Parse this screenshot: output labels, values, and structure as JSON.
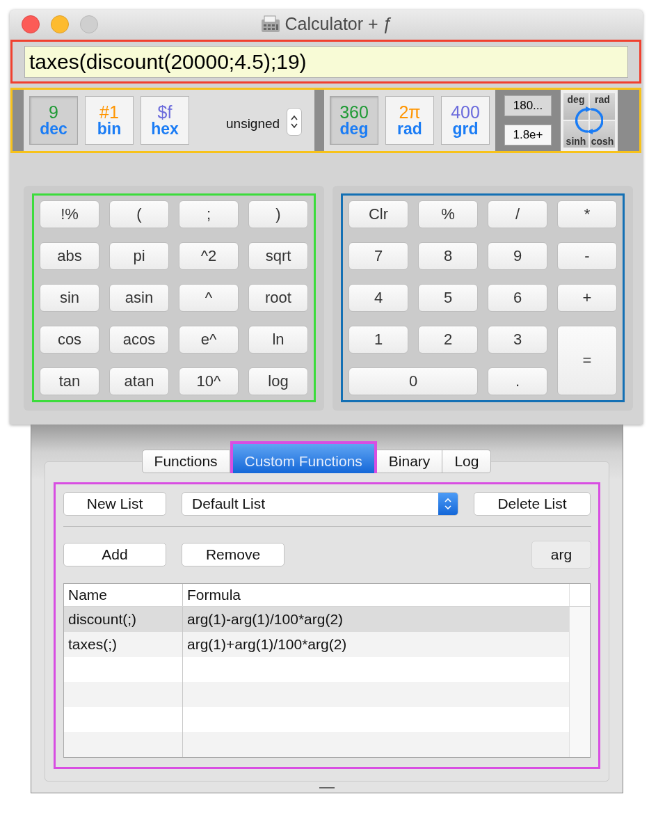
{
  "window": {
    "title": "Calculator + ƒ"
  },
  "expression": {
    "value": "taxes(discount(20000;4.5);19)"
  },
  "base_modes": [
    {
      "value": "9",
      "label": "dec",
      "color": "#1f9a35",
      "selected": true
    },
    {
      "value": "#1",
      "label": "bin",
      "color": "#ff9500",
      "selected": false
    },
    {
      "value": "$f",
      "label": "hex",
      "color": "#6b6bdc",
      "selected": false
    }
  ],
  "sign_mode": {
    "label": "unsigned"
  },
  "angle_modes": [
    {
      "value": "360",
      "label": "deg",
      "color": "#1f9a35",
      "selected": true
    },
    {
      "value": "2π",
      "label": "rad",
      "color": "#ff9500",
      "selected": false
    },
    {
      "value": "400",
      "label": "grd",
      "color": "#6b6bdc",
      "selected": false
    }
  ],
  "display_formats": [
    {
      "label": "180...",
      "selected": true
    },
    {
      "label": "1.8e+",
      "selected": false
    }
  ],
  "function_toggles": [
    {
      "label": "deg"
    },
    {
      "label": "rad"
    },
    {
      "label": "sinh"
    },
    {
      "label": "cosh"
    }
  ],
  "function_keys": [
    "!%",
    "(",
    ";",
    ")",
    "abs",
    "pi",
    "^2",
    "sqrt",
    "sin",
    "asin",
    "^",
    "root",
    "cos",
    "acos",
    "e^",
    "ln",
    "tan",
    "atan",
    "10^",
    "log"
  ],
  "number_keys": [
    {
      "label": "Clr",
      "kind": "normal"
    },
    {
      "label": "%",
      "kind": "normal"
    },
    {
      "label": "/",
      "kind": "normal"
    },
    {
      "label": "*",
      "kind": "normal"
    },
    {
      "label": "7",
      "kind": "normal"
    },
    {
      "label": "8",
      "kind": "normal"
    },
    {
      "label": "9",
      "kind": "normal"
    },
    {
      "label": "-",
      "kind": "normal"
    },
    {
      "label": "4",
      "kind": "normal"
    },
    {
      "label": "5",
      "kind": "normal"
    },
    {
      "label": "6",
      "kind": "normal"
    },
    {
      "label": "+",
      "kind": "normal"
    },
    {
      "label": "1",
      "kind": "normal"
    },
    {
      "label": "2",
      "kind": "normal"
    },
    {
      "label": "3",
      "kind": "normal"
    },
    {
      "label": "=",
      "kind": "tall"
    },
    {
      "label": "0",
      "kind": "wide"
    },
    {
      "label": ".",
      "kind": "normal"
    }
  ],
  "drawer": {
    "tabs": [
      {
        "label": "Functions",
        "selected": false
      },
      {
        "label": "Custom Functions",
        "selected": true
      },
      {
        "label": "Binary",
        "selected": false
      },
      {
        "label": "Log",
        "selected": false
      }
    ],
    "new_list_button": "New List",
    "list_popup": {
      "value": "Default List"
    },
    "delete_list_button": "Delete List",
    "add_button": "Add",
    "remove_button": "Remove",
    "arg_button": "arg",
    "table": {
      "columns": [
        "Name",
        "Formula"
      ],
      "rows": [
        {
          "cells": [
            "discount(;)",
            "arg(1)-arg(1)/100*arg(2)"
          ],
          "selected": true
        },
        {
          "cells": [
            "taxes(;)",
            "arg(1)+arg(1)/100*arg(2)"
          ],
          "selected": false
        }
      ]
    }
  }
}
